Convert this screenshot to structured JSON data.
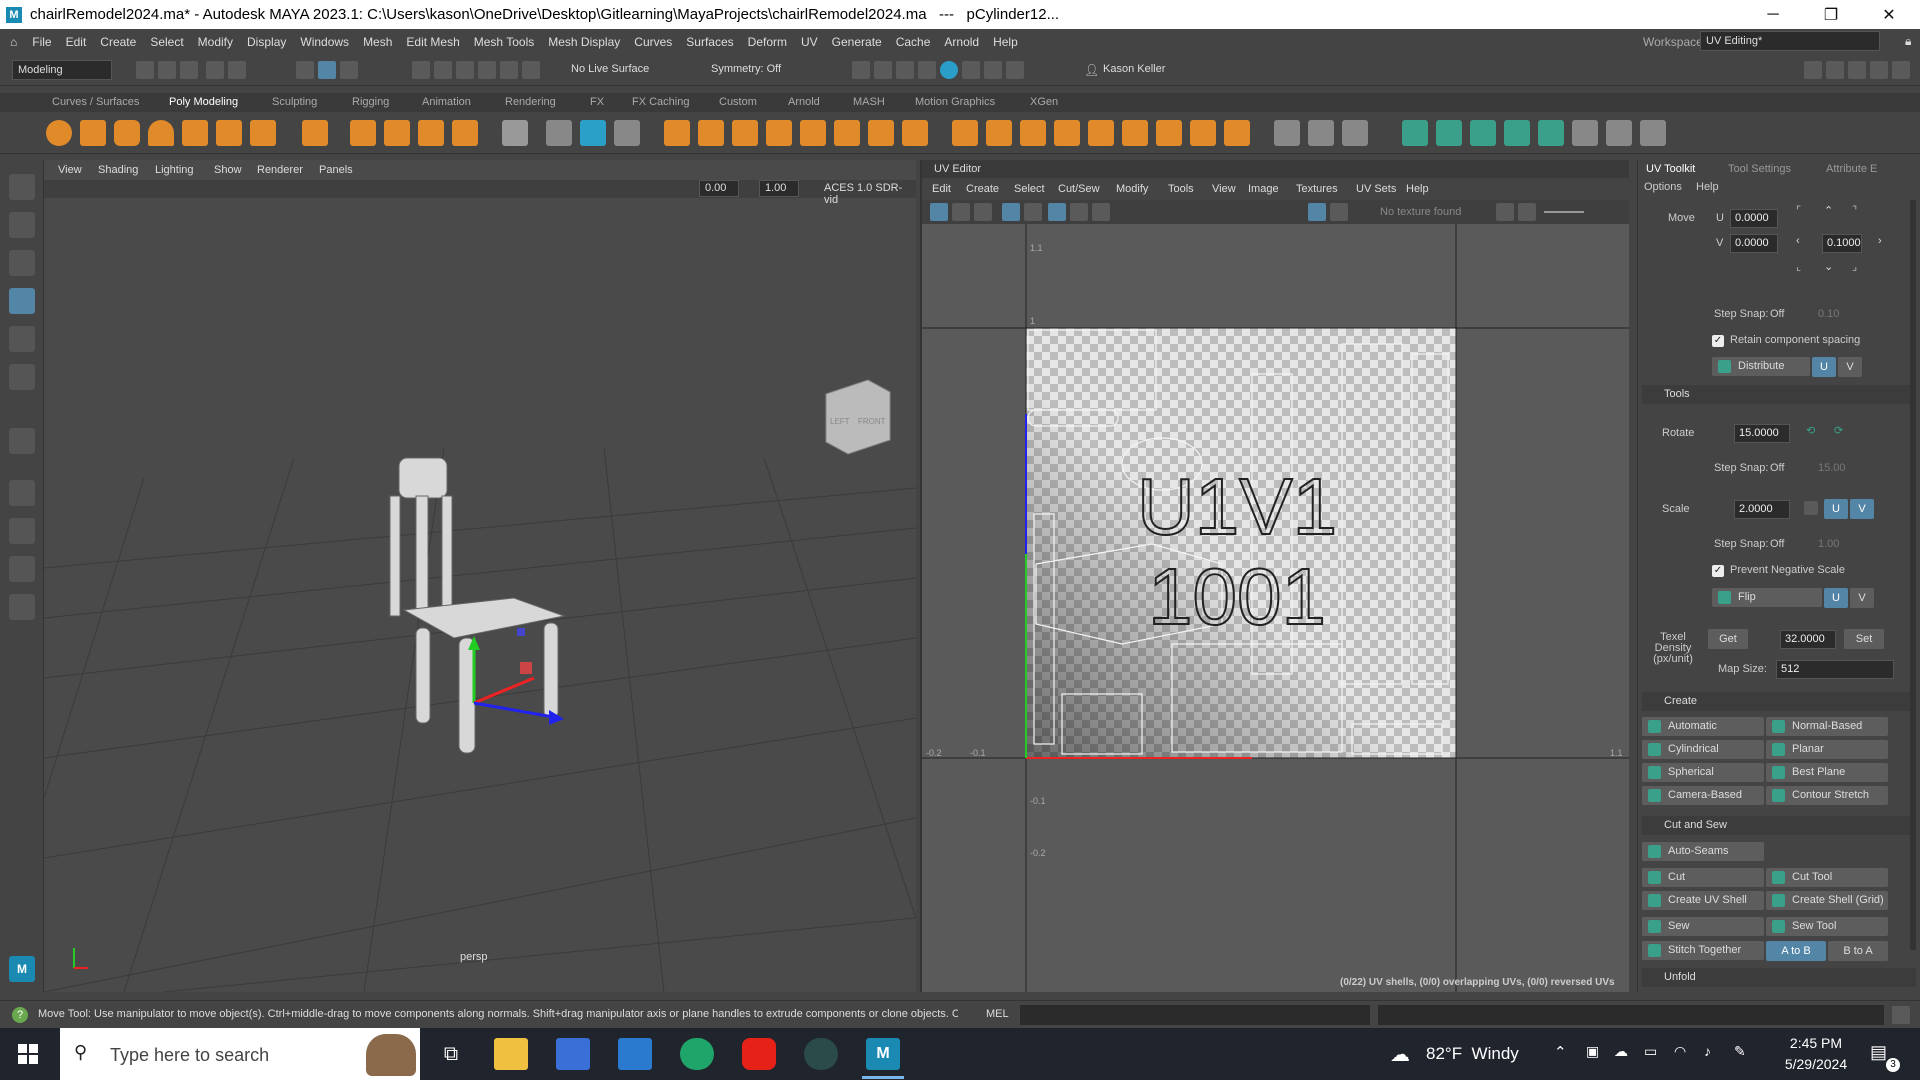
{
  "titlebar": {
    "app_icon": "maya-logo",
    "title": "chairlRemodel2024.ma* - Autodesk MAYA 2023.1: C:\\Users\\kason\\OneDrive\\Desktop\\Gitlearning\\MayaProjects\\chairlRemodel2024.ma   ---   pCylinder12...",
    "minimize": "─",
    "restore": "❐",
    "close": "✕"
  },
  "menubar": {
    "items": [
      "File",
      "Edit",
      "Create",
      "Select",
      "Modify",
      "Display",
      "Windows",
      "Mesh",
      "Edit Mesh",
      "Mesh Tools",
      "Mesh Display",
      "Curves",
      "Surfaces",
      "Deform",
      "UV",
      "Generate",
      "Cache",
      "Arnold",
      "Help"
    ],
    "workspace_label": "Workspace:",
    "workspace_value": "UV Editing*"
  },
  "statusline": {
    "mode": "Modeling",
    "live_surface": "No Live Surface",
    "symmetry": "Symmetry: Off",
    "user": "Kason Keller"
  },
  "shelf": {
    "tabs": [
      "Curves / Surfaces",
      "Poly Modeling",
      "Sculpting",
      "Rigging",
      "Animation",
      "Rendering",
      "FX",
      "FX Caching",
      "Custom",
      "Arnold",
      "MASH",
      "Motion Graphics",
      "XGen"
    ],
    "active_tab": "Poly Modeling"
  },
  "viewport": {
    "menu": [
      "View",
      "Shading",
      "Lighting",
      "Show",
      "Renderer",
      "Panels"
    ],
    "field1": "0.00",
    "field2": "1.00",
    "color_space": "ACES 1.0 SDR-vid",
    "camera_label": "persp",
    "viewcube_left": "LEFT",
    "viewcube_front": "FRONT"
  },
  "uv_editor": {
    "title": "UV Editor",
    "menu": [
      "Edit",
      "Create",
      "Select",
      "Cut/Sew",
      "Modify",
      "Tools",
      "View",
      "Image",
      "Textures",
      "UV Sets",
      "Help"
    ],
    "texture_status": "No texture found",
    "tile_label_line1": "U1V1",
    "tile_label_line2": "1001",
    "axis_labels": {
      "top": "1.1",
      "top2": "1",
      "left1": "-0.2",
      "left2": "-0.1",
      "right": "1.1",
      "bottom1": "-0.1",
      "bottom2": "-0.2"
    },
    "status": "(0/22) UV shells, (0/0) overlapping UVs, (0/0) reversed UVs"
  },
  "toolkit": {
    "tabs": [
      "UV Toolkit",
      "Tool Settings",
      "Attribute E"
    ],
    "menu": [
      "Options",
      "Help"
    ],
    "move_label": "Move",
    "u_label": "U",
    "v_label": "V",
    "u_value": "0.0000",
    "v_value": "0.0000",
    "move_step": "0.1000",
    "step_snap_label": "Step Snap:",
    "step_snap_value": "Off",
    "step_snap_num": "0.10",
    "retain_spacing": "Retain component spacing",
    "distribute": "Distribute",
    "btn_u": "U",
    "btn_v": "V",
    "tools_section": "Tools",
    "rotate_label": "Rotate",
    "rotate_value": "15.0000",
    "rotate_snap_num": "15.00",
    "scale_label": "Scale",
    "scale_value": "2.0000",
    "scale_snap_num": "1.00",
    "prevent_negative": "Prevent Negative Scale",
    "flip": "Flip",
    "texel_label": "Texel Density (px/unit)",
    "get": "Get",
    "texel_value": "32.0000",
    "set": "Set",
    "map_size_label": "Map Size:",
    "map_size_value": "512",
    "create_section": "Create",
    "create_buttons": [
      "Automatic",
      "Normal-Based",
      "Cylindrical",
      "Planar",
      "Spherical",
      "Best Plane",
      "Camera-Based",
      "Contour Stretch"
    ],
    "cut_sew_section": "Cut and Sew",
    "auto_seams": "Auto-Seams",
    "cut": "Cut",
    "cut_tool": "Cut Tool",
    "create_uv_shell": "Create UV Shell",
    "create_shell_grid": "Create Shell (Grid)",
    "sew": "Sew",
    "sew_tool": "Sew Tool",
    "stitch_together": "Stitch Together",
    "a_to_b": "A to B",
    "b_to_a": "B to A",
    "unfold_section": "Unfold"
  },
  "helpline": {
    "message": "Move Tool: Use manipulator to move object(s). Ctrl+middle-drag to move components along normals. Shift+drag manipulator axis or plane handles to extrude components or clone objects. Ctrl+Shift+drag to c",
    "mel": "MEL"
  },
  "taskbar": {
    "search_placeholder": "Type here to search",
    "weather": "82°F  Windy",
    "time": "2:45 PM",
    "date": "5/29/2024",
    "notif_count": "3"
  },
  "colors": {
    "maya_blue": "#1b8ab3",
    "selected_blue": "#5285a6",
    "panel_bg": "#444444",
    "taskbar_bg": "#20242c"
  }
}
